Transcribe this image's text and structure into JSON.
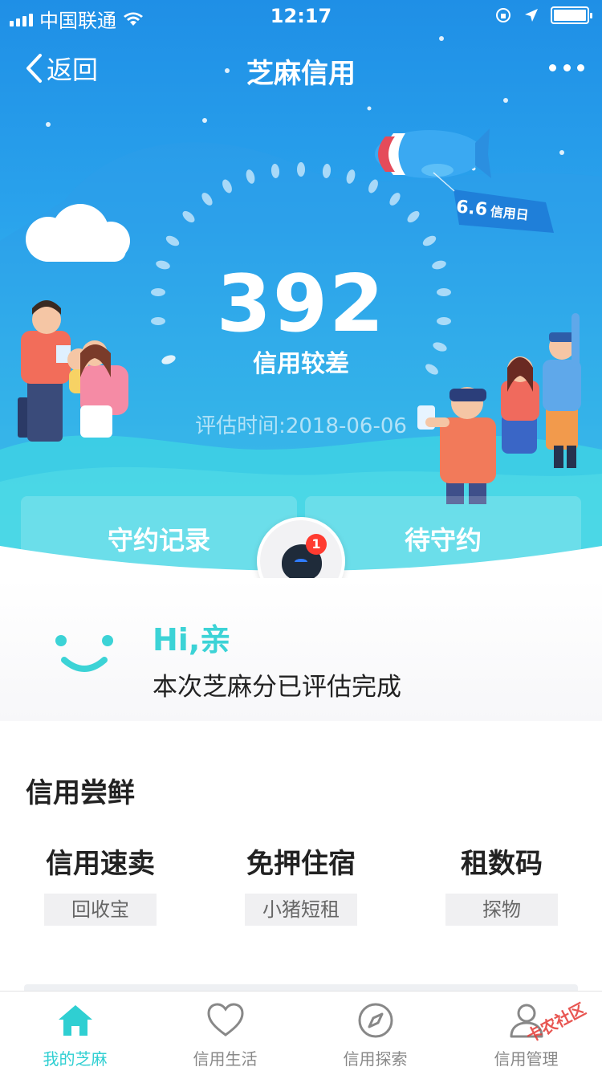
{
  "status_bar": {
    "carrier": "中国联通",
    "time": "12:17"
  },
  "nav": {
    "back_label": "返回",
    "title": "芝麻信用"
  },
  "score": {
    "value": "392",
    "level": "信用较差",
    "eval_time": "评估时间:2018-06-06"
  },
  "badge": {
    "label": "6.6",
    "text": "信用日"
  },
  "tabs_top": {
    "left": "守约记录",
    "right": "待守约"
  },
  "robot": {
    "badge_count": "1"
  },
  "greeting": {
    "hi": "Hi,亲",
    "message": "本次芝麻分已评估完成"
  },
  "section": {
    "title": "信用尝鲜",
    "items": [
      {
        "title": "信用速卖",
        "tag": "回收宝"
      },
      {
        "title": "免押住宿",
        "tag": "小猪短租"
      },
      {
        "title": "租数码",
        "tag": "探物"
      }
    ]
  },
  "tabbar": {
    "items": [
      {
        "label": "我的芝麻",
        "icon": "home-icon",
        "active": true
      },
      {
        "label": "信用生活",
        "icon": "heart-icon",
        "active": false
      },
      {
        "label": "信用探索",
        "icon": "compass-icon",
        "active": false
      },
      {
        "label": "信用管理",
        "icon": "user-icon",
        "active": false
      }
    ]
  },
  "watermark": "卡农社区",
  "colors": {
    "accent": "#2fcfd2",
    "hero_top": "#1f8fe6",
    "hero_bottom": "#4fd6e6",
    "badge_red": "#ff3b30"
  }
}
